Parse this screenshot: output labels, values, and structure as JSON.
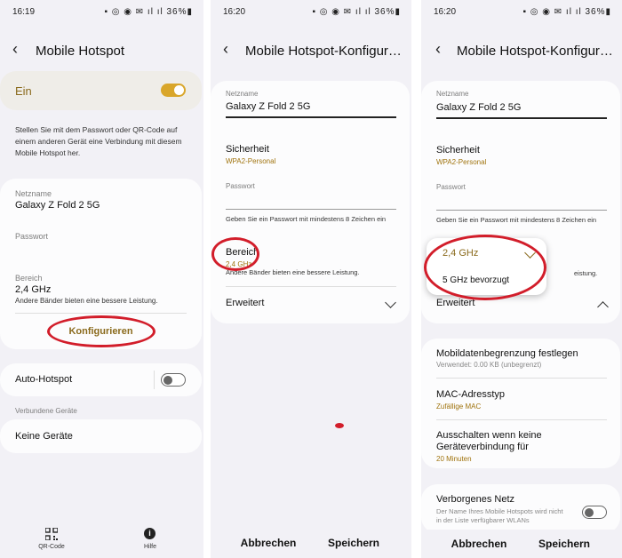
{
  "screen1": {
    "time": "16:19",
    "status_icons": "▪ ◎ ◉ ✉ ıl ıl 36%▮",
    "title": "Mobile Hotspot",
    "master_label": "Ein",
    "description": "Stellen Sie mit dem Passwort oder QR-Code auf einem anderen Gerät eine Verbindung mit diesem Mobile Hotspot her.",
    "network_name_label": "Netzname",
    "network_name_value": "Galaxy Z Fold 2 5G",
    "password_label": "Passwort",
    "band_label": "Bereich",
    "band_value": "2,4 GHz",
    "band_hint": "Andere Bänder bieten eine bessere Leistung.",
    "configure_button": "Konfigurieren",
    "auto_hotspot_label": "Auto-Hotspot",
    "connected_devices_header": "Verbundene Geräte",
    "no_devices": "Keine Geräte",
    "qr_label": "QR-Code",
    "help_label": "Hilfe"
  },
  "screen2": {
    "time": "16:20",
    "status_icons": "▪ ◎ ◉ ✉ ıl ıl 36%▮",
    "title": "Mobile Hotspot-Konfigurat...",
    "network_name_label": "Netzname",
    "network_name_value": "Galaxy Z Fold 2 5G",
    "security_label": "Sicherheit",
    "security_value": "WPA2-Personal",
    "password_label": "Passwort",
    "password_hint": "Geben Sie ein Passwort mit mindestens 8 Zeichen ein",
    "band_label": "Bereich",
    "band_value": "2,4 GHz",
    "band_hint": "Andere Bänder bieten eine bessere Leistung.",
    "advanced_label": "Erweitert",
    "cancel_button": "Abbrechen",
    "save_button": "Speichern"
  },
  "screen3": {
    "time": "16:20",
    "status_icons": "▪ ◎ ◉ ✉ ıl ıl 36%▮",
    "title": "Mobile Hotspot-Konfigurat...",
    "network_name_label": "Netzname",
    "network_name_value": "Galaxy Z Fold 2 5G",
    "security_label": "Sicherheit",
    "security_value": "WPA2-Personal",
    "password_label": "Passwort",
    "password_hint": "Geben Sie ein Passwort mit mindestens 8 Zeichen ein",
    "band_options": [
      "2,4 GHz",
      "5 GHz bevorzugt"
    ],
    "band_hint_tail": "eistung.",
    "advanced_label": "Erweitert",
    "data_limit_label": "Mobildatenbegrenzung festlegen",
    "data_limit_value": "Verwendet: 0.00 KB (unbegrenzt)",
    "mac_label": "MAC-Adresstyp",
    "mac_value": "Zufällige MAC",
    "timeout_label_1": "Ausschalten wenn keine",
    "timeout_label_2": "Geräteverbindung für",
    "timeout_value": "20 Minuten",
    "hidden_label": "Verborgenes Netz",
    "hidden_desc": "Der Name Ihres Mobile Hotspots wird nicht in der Liste verfügbarer WLANs",
    "cancel_button": "Abbrechen",
    "save_button": "Speichern"
  },
  "colors": {
    "accent": "#d9a62a",
    "sub_text": "#a0740f",
    "annotation": "#d21d2a",
    "background": "#f2f1f6",
    "card": "#fcfcfd"
  }
}
